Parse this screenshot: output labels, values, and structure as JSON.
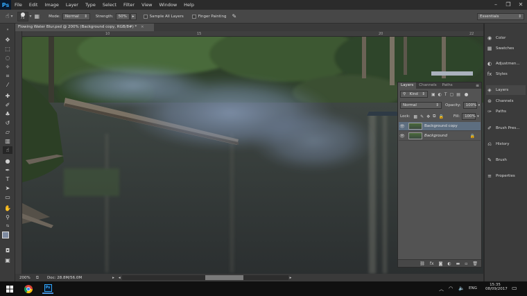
{
  "app": {
    "logo": "Ps",
    "menu": [
      "File",
      "Edit",
      "Image",
      "Layer",
      "Type",
      "Select",
      "Filter",
      "View",
      "Window",
      "Help"
    ]
  },
  "options": {
    "brush_size": "75",
    "mode_label": "Mode:",
    "mode_value": "Normal",
    "strength_label": "Strength:",
    "strength_value": "50%",
    "sample_all_layers": "Sample All Layers",
    "finger_painting": "Finger Painting",
    "workspace": "Essentials"
  },
  "document": {
    "tab_title": "Flowing Water Blur.psd @ 200% (Background copy, RGB/8#) *",
    "ruler_ticks": [
      "10",
      "15",
      "20",
      "22"
    ],
    "zoom": "200%",
    "doc_info": "Doc: 28.8M/56.0M"
  },
  "layers_panel": {
    "tabs": [
      "Layers",
      "Channels",
      "Paths"
    ],
    "filter_kind": "Kind",
    "blend_mode": "Normal",
    "opacity_label": "Opacity:",
    "opacity": "100%",
    "lock_label": "Lock:",
    "fill_label": "Fill:",
    "fill": "100%",
    "layers": [
      {
        "name": "Background copy",
        "selected": true
      },
      {
        "name": "Background",
        "selected": false
      }
    ],
    "footer_icons": [
      "link-icon",
      "fx-icon",
      "mask-icon",
      "adjustment-icon",
      "folder-icon",
      "new-layer-icon",
      "trash-icon"
    ]
  },
  "dock": {
    "items": [
      "Color",
      "Swatches",
      "Adjustmen...",
      "Styles",
      "Layers",
      "Channels",
      "Paths",
      "Brush Pres...",
      "History",
      "Brush",
      "Properties"
    ]
  },
  "taskbar": {
    "language": "ENG",
    "time": "15:35",
    "date": "08/09/2017"
  },
  "colors": {
    "accent": "#31a8ff",
    "panel": "#535353",
    "dark": "#2b2b2b",
    "selected_layer": "#5d6e80"
  }
}
